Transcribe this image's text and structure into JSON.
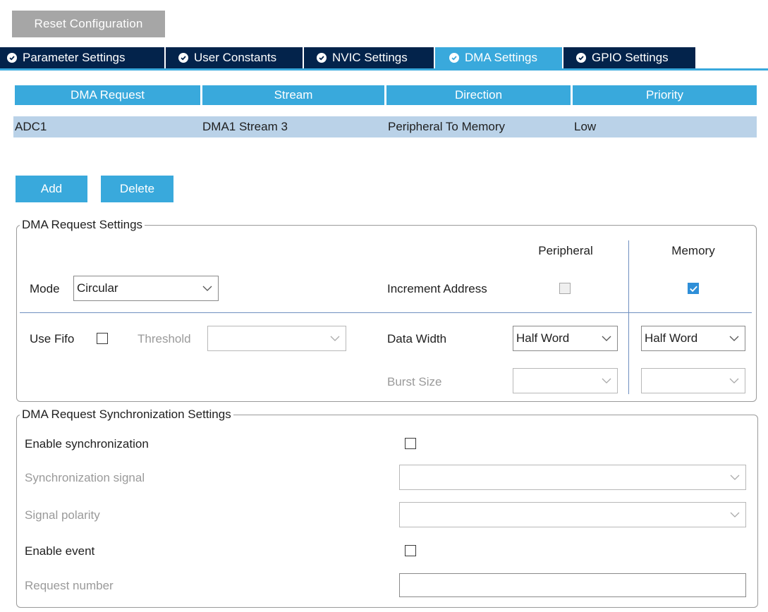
{
  "toolbar": {
    "reset_label": "Reset Configuration"
  },
  "tabs": [
    {
      "label": "Parameter Settings",
      "active": false
    },
    {
      "label": "User Constants",
      "active": false
    },
    {
      "label": "NVIC Settings",
      "active": false
    },
    {
      "label": "DMA Settings",
      "active": true
    },
    {
      "label": "GPIO Settings",
      "active": false
    }
  ],
  "table": {
    "headers": [
      "DMA Request",
      "Stream",
      "Direction",
      "Priority"
    ],
    "rows": [
      [
        "ADC1",
        "DMA1 Stream 3",
        "Peripheral To Memory",
        "Low"
      ]
    ]
  },
  "buttons": {
    "add": "Add",
    "delete": "Delete"
  },
  "request_settings": {
    "legend": "DMA Request Settings",
    "mode_label": "Mode",
    "mode_value": "Circular",
    "peripheral_header": "Peripheral",
    "memory_header": "Memory",
    "increment_label": "Increment Address",
    "peripheral_increment": false,
    "memory_increment": true,
    "use_fifo_label": "Use Fifo",
    "use_fifo": false,
    "threshold_label": "Threshold",
    "threshold_value": "",
    "data_width_label": "Data Width",
    "peripheral_data_width": "Half Word",
    "memory_data_width": "Half Word",
    "burst_size_label": "Burst Size",
    "peripheral_burst": "",
    "memory_burst": ""
  },
  "sync_settings": {
    "legend": "DMA Request Synchronization Settings",
    "enable_sync_label": "Enable synchronization",
    "enable_sync": false,
    "sync_signal_label": "Synchronization signal",
    "sync_signal_value": "",
    "signal_polarity_label": "Signal polarity",
    "signal_polarity_value": "",
    "enable_event_label": "Enable event",
    "enable_event": false,
    "request_number_label": "Request number",
    "request_number_value": ""
  },
  "colors": {
    "tab_bg": "#03234b",
    "accent": "#39a9dc",
    "row_bg": "#bad2e8",
    "reset_bg": "#a6a6a6"
  }
}
